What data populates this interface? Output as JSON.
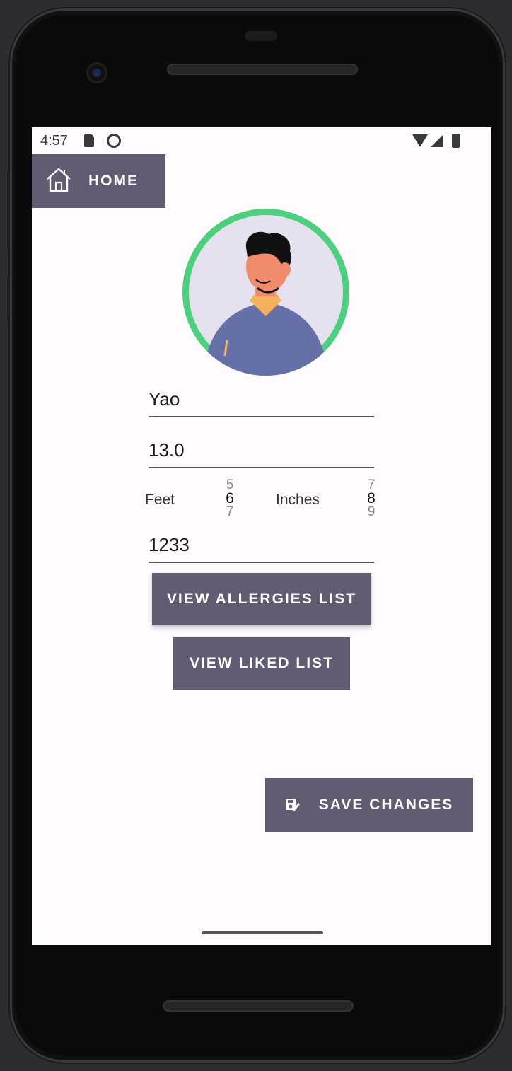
{
  "status_bar": {
    "time": "4:57"
  },
  "header": {
    "home_label": "HOME",
    "home_icon": "home-icon"
  },
  "profile": {
    "name": "Yao",
    "weight": "13.0",
    "height_picker": {
      "feet_label": "Feet",
      "feet_values": [
        "5",
        "6",
        "7"
      ],
      "feet_selected": "6",
      "inches_label": "Inches",
      "inches_values": [
        "7",
        "8",
        "9"
      ],
      "inches_selected": "8"
    },
    "id_field": "1233"
  },
  "actions": {
    "view_allergies": "VIEW ALLERGIES LIST",
    "view_liked": "VIEW LIKED LIST",
    "save_changes": "SAVE CHANGES",
    "save_icon": "save-edit-icon"
  },
  "colors": {
    "accent": "#625b71",
    "avatar_ring": "#4cd07d",
    "screen_bg": "#fffbfe"
  }
}
